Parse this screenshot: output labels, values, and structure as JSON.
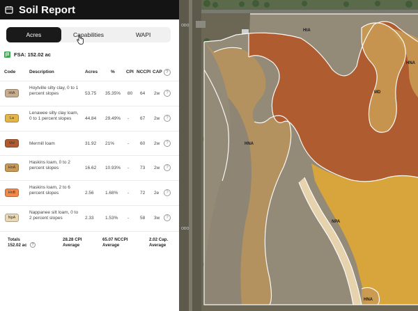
{
  "app": {
    "title": "Soil Report",
    "icon": "calendar-icon"
  },
  "tabs": [
    {
      "label": "Acres",
      "active": true
    },
    {
      "label": "Capabilities",
      "active": false
    },
    {
      "label": "WAPI",
      "active": false
    }
  ],
  "fsa": {
    "label": "FSA: 152.02 ac",
    "icon": "flag-icon",
    "color": "#3aa850"
  },
  "table": {
    "headers": [
      "Code",
      "Description",
      "Acres",
      "%",
      "CPI",
      "NCCPI",
      "CAP"
    ],
    "rows": [
      {
        "code": "HtA",
        "color": "#c7ad8f",
        "description": "Hoytville silty clay, 0 to 1 percent slopes",
        "acres": "53.75",
        "pct": "35.35%",
        "cpi": "80",
        "nccpi": "64",
        "cap": "2w"
      },
      {
        "code": "La",
        "color": "#e3b447",
        "description": "Lenawee silty clay loam, 0 to 1 percent slopes",
        "acres": "44.84",
        "pct": "29.49%",
        "cpi": "-",
        "nccpi": "67",
        "cap": "2w"
      },
      {
        "code": "Md",
        "color": "#b05a2d",
        "description": "Mermill loam",
        "acres": "31.92",
        "pct": "21%",
        "cpi": "-",
        "nccpi": "60",
        "cap": "2w"
      },
      {
        "code": "HnA",
        "color": "#c99a52",
        "description": "Haskins loam, 0 to 2 percent slopes",
        "acres": "16.62",
        "pct": "10.93%",
        "cpi": "-",
        "nccpi": "73",
        "cap": "2w"
      },
      {
        "code": "HnB",
        "color": "#f0894a",
        "description": "Haskins loam, 2 to 6 percent slopes",
        "acres": "2.56",
        "pct": "1.68%",
        "cpi": "-",
        "nccpi": "72",
        "cap": "2e"
      },
      {
        "code": "NpA",
        "color": "#ead7b4",
        "description": "Nappanee silt loam, 0 to 2 percent slopes",
        "acres": "2.33",
        "pct": "1.53%",
        "cpi": "-",
        "nccpi": "58",
        "cap": "3w"
      }
    ]
  },
  "totals": {
    "label": "Totals",
    "acres": "152.02 ac",
    "cpi_value": "28.28 CPI",
    "cpi_sub": "Average",
    "nccpi_value": "65.07 NCCPI",
    "nccpi_sub": "Average",
    "cap_value": "2.02 Cap.",
    "cap_sub": "Average"
  },
  "map": {
    "labels": {
      "hta": "HtA",
      "hna_top": "HNA",
      "md": "MD",
      "hna_mid": "HNA",
      "npa": "NPA",
      "hna_bottom": "HNA"
    },
    "road_labels": {
      "left_top": "ODO",
      "left_bottom": "ODO"
    }
  }
}
